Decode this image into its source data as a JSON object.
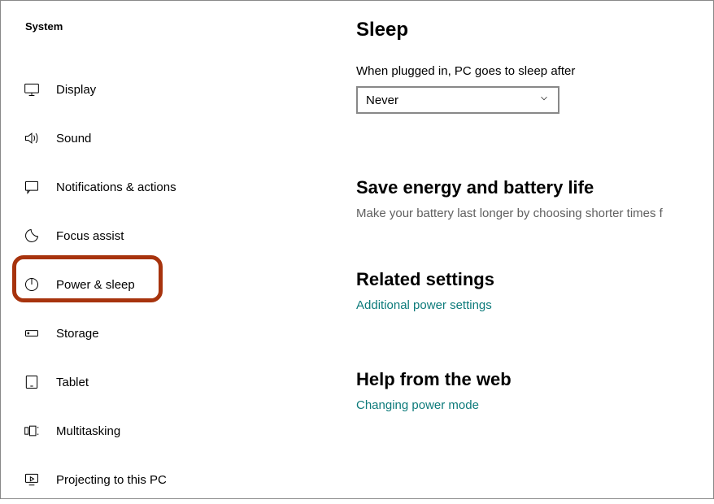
{
  "sidebar": {
    "title": "System",
    "items": [
      {
        "label": "Display"
      },
      {
        "label": "Sound"
      },
      {
        "label": "Notifications & actions"
      },
      {
        "label": "Focus assist"
      },
      {
        "label": "Power & sleep"
      },
      {
        "label": "Storage"
      },
      {
        "label": "Tablet"
      },
      {
        "label": "Multitasking"
      },
      {
        "label": "Projecting to this PC"
      }
    ]
  },
  "main": {
    "sleep_heading": "Sleep",
    "sleep_label": "When plugged in, PC goes to sleep after",
    "sleep_value": "Never",
    "energy_heading": "Save energy and battery life",
    "energy_desc": "Make your battery last longer by choosing shorter times f",
    "related_heading": "Related settings",
    "related_link": "Additional power settings",
    "help_heading": "Help from the web",
    "help_link": "Changing power mode"
  }
}
